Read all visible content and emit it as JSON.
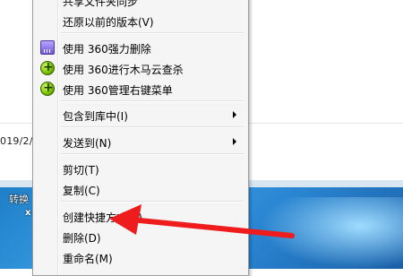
{
  "background": {
    "date_fragment": "019/2/",
    "desktop_icon_label": "转换",
    "desktop_icon_badge": "x"
  },
  "menu": {
    "items": [
      {
        "label": "共享文件夹同步",
        "icon": null,
        "submenu": false
      },
      {
        "label": "还原以前的版本(V)",
        "icon": null,
        "submenu": false
      },
      {
        "separator": true
      },
      {
        "label": "使用 360强力删除",
        "icon": "shredder-icon",
        "submenu": false
      },
      {
        "label": "使用 360进行木马云查杀",
        "icon": "360-shield-icon",
        "submenu": false
      },
      {
        "label": "使用 360管理右键菜单",
        "icon": "360-shield-icon",
        "submenu": false
      },
      {
        "separator": true
      },
      {
        "label": "包含到库中(I)",
        "icon": null,
        "submenu": true
      },
      {
        "separator": true
      },
      {
        "label": "发送到(N)",
        "icon": null,
        "submenu": true
      },
      {
        "separator": true
      },
      {
        "label": "剪切(T)",
        "icon": null,
        "submenu": false
      },
      {
        "label": "复制(C)",
        "icon": null,
        "submenu": false
      },
      {
        "separator": true
      },
      {
        "label": "创建快捷方式(S)",
        "icon": null,
        "submenu": false
      },
      {
        "label": "删除(D)",
        "icon": null,
        "submenu": false
      },
      {
        "label": "重命名(M)",
        "icon": null,
        "submenu": false
      }
    ]
  },
  "annotation": {
    "arrow_color": "#ee1c1c",
    "points_to": "删除(D)"
  }
}
